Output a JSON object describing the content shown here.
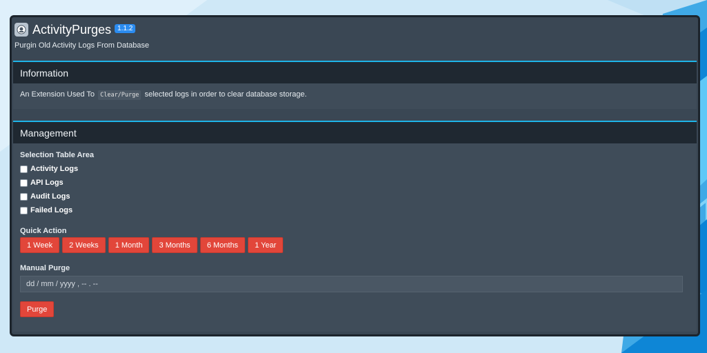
{
  "app": {
    "title": "ActivityPurges",
    "version": "1.1.2",
    "subtitle": "Purgin Old Activity Logs From Database"
  },
  "information": {
    "heading": "Information",
    "text_before": "An Extension Used To",
    "code": "Clear/Purge",
    "text_after": "selected logs in order to clear database storage."
  },
  "management": {
    "heading": "Management",
    "selection_label": "Selection Table Area",
    "checkboxes": [
      {
        "label": "Activity Logs",
        "checked": false
      },
      {
        "label": "API Logs",
        "checked": false
      },
      {
        "label": "Audit Logs",
        "checked": false
      },
      {
        "label": "Failed Logs",
        "checked": false
      }
    ],
    "quick_action_label": "Quick Action",
    "quick_actions": [
      "1 Week",
      "2 Weeks",
      "1 Month",
      "3 Months",
      "6 Months",
      "1 Year"
    ],
    "manual_purge_label": "Manual Purge",
    "date_placeholder": "dd / mm / yyyy ,  -- . --",
    "purge_button": "Purge"
  },
  "colors": {
    "accent": "#1eb4e8",
    "danger": "#e2463a",
    "badge": "#2b8cf0",
    "panel": "#3f4c59",
    "panel_head": "#1f2831"
  }
}
